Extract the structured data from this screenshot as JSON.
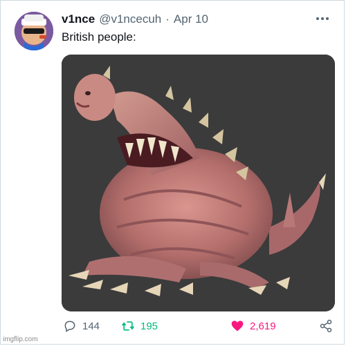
{
  "tweet": {
    "display_name": "v1nce",
    "handle": "@v1ncecuh",
    "separator": "·",
    "date": "Apr 10",
    "text": "British people:",
    "avatar_icon": "cartoon-avatar-with-sunglasses-and-hat",
    "more_icon": "more-options-icon"
  },
  "metrics": {
    "replies": "144",
    "retweets": "195",
    "likes": "2,619"
  },
  "colors": {
    "text_primary": "#0f1419",
    "text_secondary": "#536471",
    "retweet_green": "#00ba7c",
    "like_pink": "#f91880",
    "media_background": "#3b3b3b"
  },
  "watermark": "imgflip.com"
}
